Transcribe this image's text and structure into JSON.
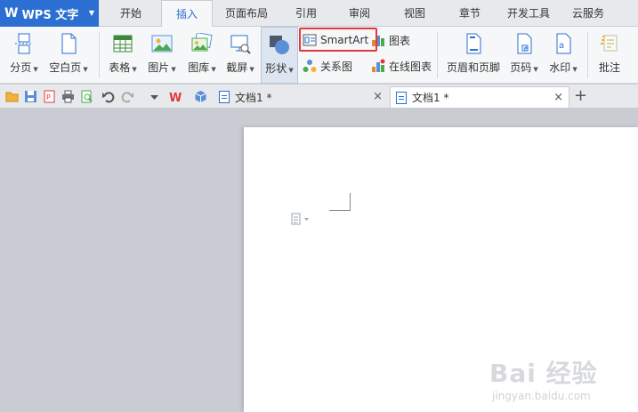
{
  "app": {
    "logo": "W",
    "name": "WPS 文字",
    "caret": "▼"
  },
  "menu_tabs": [
    {
      "label": "开始"
    },
    {
      "label": "插入"
    },
    {
      "label": "页面布局"
    },
    {
      "label": "引用"
    },
    {
      "label": "审阅"
    },
    {
      "label": "视图"
    },
    {
      "label": "章节"
    },
    {
      "label": "开发工具"
    },
    {
      "label": "云服务"
    }
  ],
  "active_tab": "插入",
  "ribbon": {
    "page_break": "分页",
    "blank_page": "空白页",
    "table": "表格",
    "picture": "图片",
    "gallery": "图库",
    "screenshot": "截屏",
    "shapes": "形状",
    "smartart": "SmartArt",
    "chart": "图表",
    "relation_chart": "关系图",
    "online_chart": "在线图表",
    "header_footer": "页眉和页脚",
    "page_number": "页码",
    "watermark": "水印",
    "comment": "批注"
  },
  "doc_tabs": [
    {
      "label": "文档1 *"
    },
    {
      "label": "文档1 *"
    }
  ],
  "close_glyph": "×",
  "new_tab_glyph": "+",
  "colors": {
    "brand": "#2a6fd1",
    "highlight": "#e0393e"
  },
  "watermark": {
    "main": "Bai 经验",
    "sub": "jingyan.baidu.com"
  }
}
